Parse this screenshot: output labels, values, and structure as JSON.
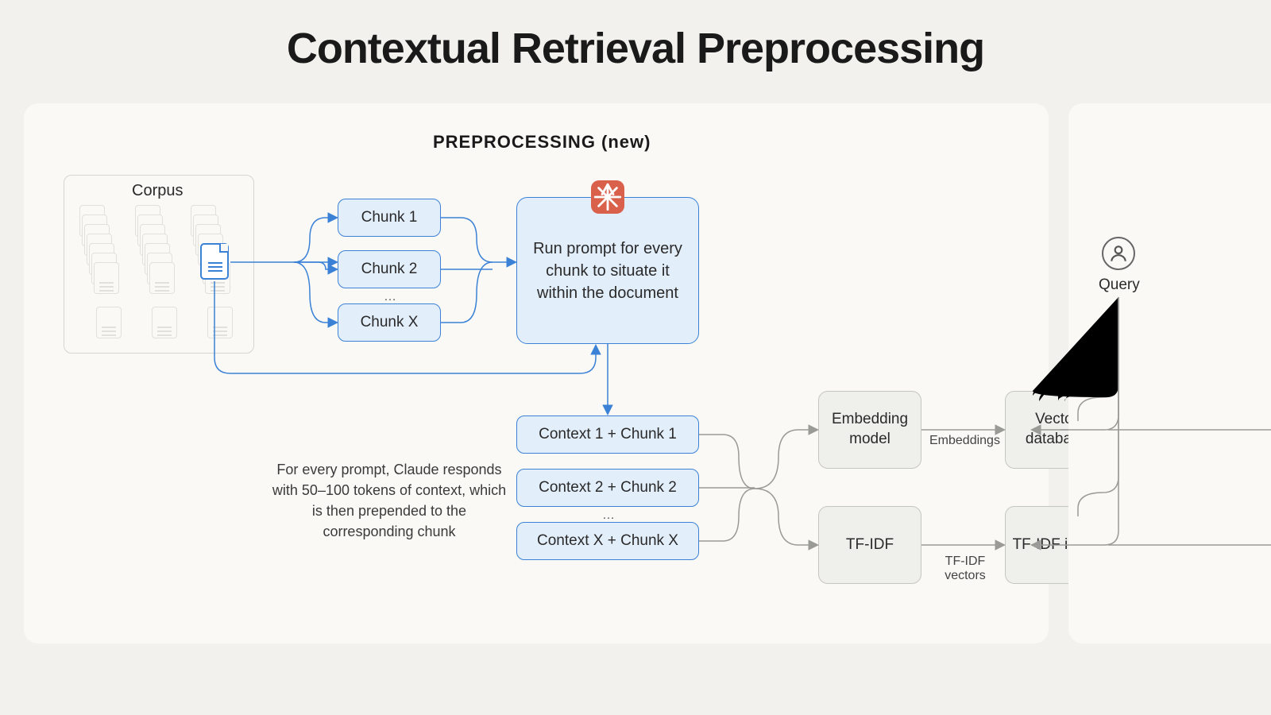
{
  "title": "Contextual Retrieval Preprocessing",
  "section": "PREPROCESSING (new)",
  "corpus": {
    "label": "Corpus"
  },
  "chunks": {
    "items": [
      "Chunk 1",
      "Chunk 2",
      "Chunk X"
    ],
    "ellipsis": "…"
  },
  "prompt_box": "Run prompt for every chunk to situate it within the document",
  "context_chunks": {
    "items": [
      "Context 1 + Chunk 1",
      "Context 2 + Chunk 2",
      "Context X + Chunk X"
    ],
    "ellipsis": "…"
  },
  "explain_text": "For every prompt, Claude responds with 50–100 tokens of context, which is then prepended to the corresponding chunk",
  "embedding_model": "Embedding model",
  "tfidf": "TF-IDF",
  "vector_db": "Vector database",
  "tfidf_index": "TF-IDF index",
  "edge_embeddings": "Embeddings",
  "edge_tfidf": "TF-IDF vectors",
  "query": "Query",
  "colors": {
    "blue": "#3b82d6",
    "gray": "#8f8f8c"
  }
}
